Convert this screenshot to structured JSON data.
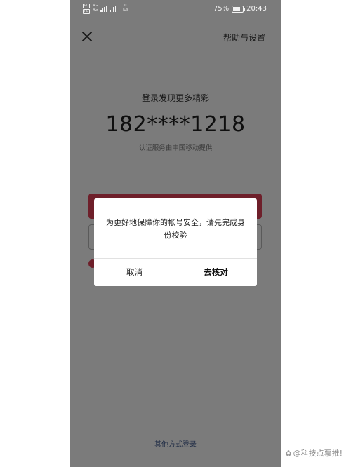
{
  "status_bar": {
    "network_tags": [
      "HD",
      "HD"
    ],
    "signal_labels": [
      "4G",
      "4G"
    ],
    "speed_value": "0",
    "speed_unit": "K/s",
    "battery_percent": "75%",
    "battery_level": 0.75,
    "time": "20:43"
  },
  "header": {
    "close_icon": "close-icon",
    "help_label": "帮助与设置"
  },
  "login": {
    "title": "登录发现更多精彩",
    "phone_number": "182****1218",
    "provider_note": "认证服务由中国移动提供"
  },
  "dialog": {
    "message": "为更好地保障你的帐号安全，请先完成身份校验",
    "cancel_label": "取消",
    "verify_label": "去核对"
  },
  "footer": {
    "other_login_label": "其他方式登录"
  },
  "watermark": {
    "text": "@科技点票推!"
  },
  "colors": {
    "overlay_bg": "#7b7b7b",
    "primary_btn": "#6e1f2a",
    "dialog_bg": "#ffffff"
  }
}
